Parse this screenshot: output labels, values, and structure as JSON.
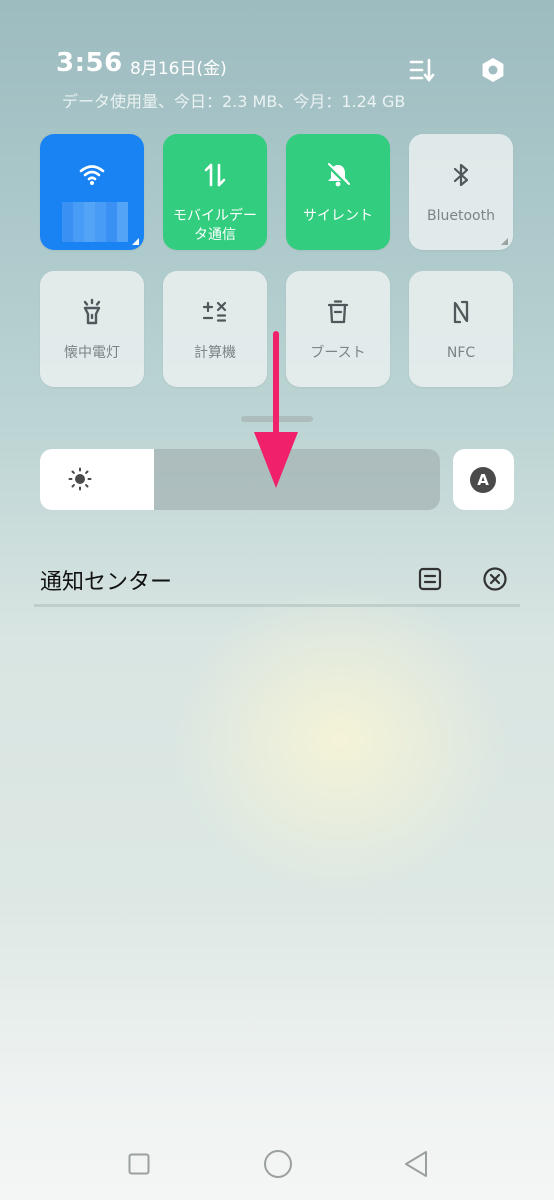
{
  "status": {
    "time": "3:56",
    "date": "8月16日(金)",
    "usage": "データ使用量、今日：2.3 MB、今月：1.24 GB"
  },
  "icons": {
    "edit": "edit-tiles-icon",
    "settings": "gear-icon",
    "brightness": "sun-icon",
    "auto_brightness": "auto-brightness-icon",
    "manage_notifications": "manage-notifications-icon",
    "clear_notifications": "clear-all-icon"
  },
  "tiles": [
    {
      "id": "wifi",
      "label": "",
      "icon": "wifi-icon",
      "state": "on"
    },
    {
      "id": "mobile-data",
      "label": "モバイルデータ通信",
      "icon": "data-arrows-icon",
      "state": "on"
    },
    {
      "id": "silent",
      "label": "サイレント",
      "icon": "bell-off-icon",
      "state": "on"
    },
    {
      "id": "bluetooth",
      "label": "Bluetooth",
      "icon": "bluetooth-icon",
      "state": "off"
    },
    {
      "id": "flashlight",
      "label": "懐中電灯",
      "icon": "flashlight-icon",
      "state": "off"
    },
    {
      "id": "calculator",
      "label": "計算機",
      "icon": "calculator-icon",
      "state": "off"
    },
    {
      "id": "boost",
      "label": "ブースト",
      "icon": "trash-icon",
      "state": "off"
    },
    {
      "id": "nfc",
      "label": "NFC",
      "icon": "nfc-icon",
      "state": "off"
    }
  ],
  "brightness": {
    "level_percent": 28.5,
    "auto_label": "A"
  },
  "notification_center": {
    "title": "通知センター"
  },
  "colors": {
    "tile_on_blue": "#1a83f3",
    "tile_on_green": "#32cd7e",
    "tile_off": "#e8eeee",
    "arrow": "#f0206a"
  }
}
